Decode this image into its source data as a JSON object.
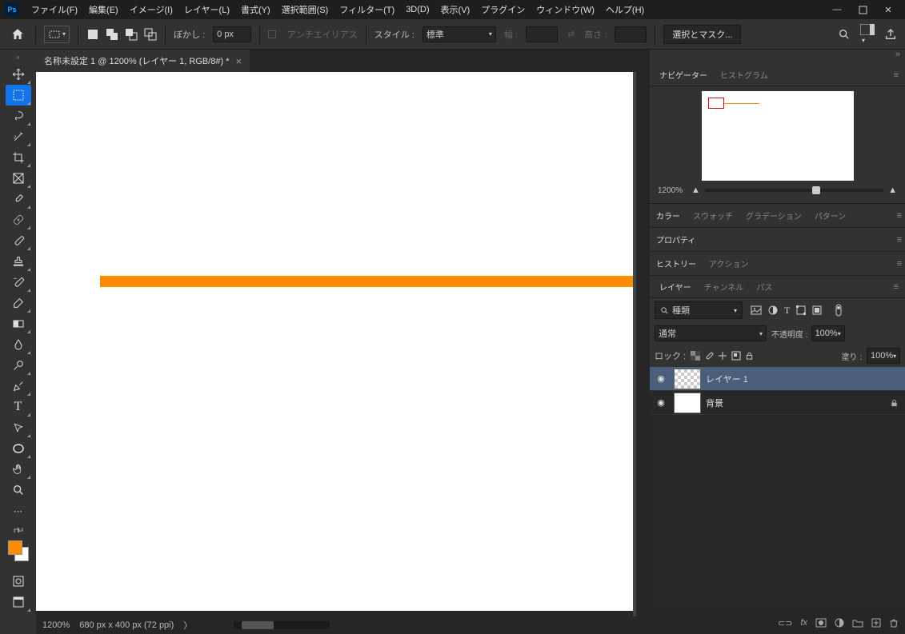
{
  "app": {
    "logo": "Ps"
  },
  "menu": {
    "file": "ファイル(F)",
    "edit": "編集(E)",
    "image": "イメージ(I)",
    "layer": "レイヤー(L)",
    "type": "書式(Y)",
    "select": "選択範囲(S)",
    "filter": "フィルター(T)",
    "threed": "3D(D)",
    "view": "表示(V)",
    "plugin": "プラグイン",
    "window": "ウィンドウ(W)",
    "help": "ヘルプ(H)"
  },
  "options": {
    "feather_label": "ぼかし :",
    "feather_value": "0 px",
    "antialias": "アンチエイリアス",
    "style_label": "スタイル :",
    "style_value": "標準",
    "width_label": "幅 :",
    "height_label": "高さ :",
    "select_mask": "選択とマスク..."
  },
  "doc": {
    "tab_title": "名称未設定 1 @ 1200% (レイヤー 1, RGB/8#) *"
  },
  "status": {
    "zoom": "1200%",
    "dims": "680 px x 400 px (72 ppi)"
  },
  "panels": {
    "navigator": {
      "tabs": {
        "nav": "ナビゲーター",
        "hist": "ヒストグラム"
      },
      "zoom": "1200%"
    },
    "color": {
      "tabs": {
        "color": "カラー",
        "swatch": "スウォッチ",
        "gradient": "グラデーション",
        "pattern": "パターン"
      }
    },
    "properties": {
      "tab": "プロパティ"
    },
    "history": {
      "tabs": {
        "history": "ヒストリー",
        "action": "アクション"
      }
    },
    "layers": {
      "tabs": {
        "layers": "レイヤー",
        "channels": "チャンネル",
        "paths": "パス"
      },
      "kind_label": "種類",
      "blend_mode": "通常",
      "opacity_label": "不透明度 :",
      "opacity_value": "100%",
      "lock_label": "ロック :",
      "fill_label": "塗り :",
      "fill_value": "100%",
      "items": [
        {
          "name": "レイヤー 1",
          "selected": true,
          "locked": false
        },
        {
          "name": "背景",
          "selected": false,
          "locked": true
        }
      ]
    }
  }
}
